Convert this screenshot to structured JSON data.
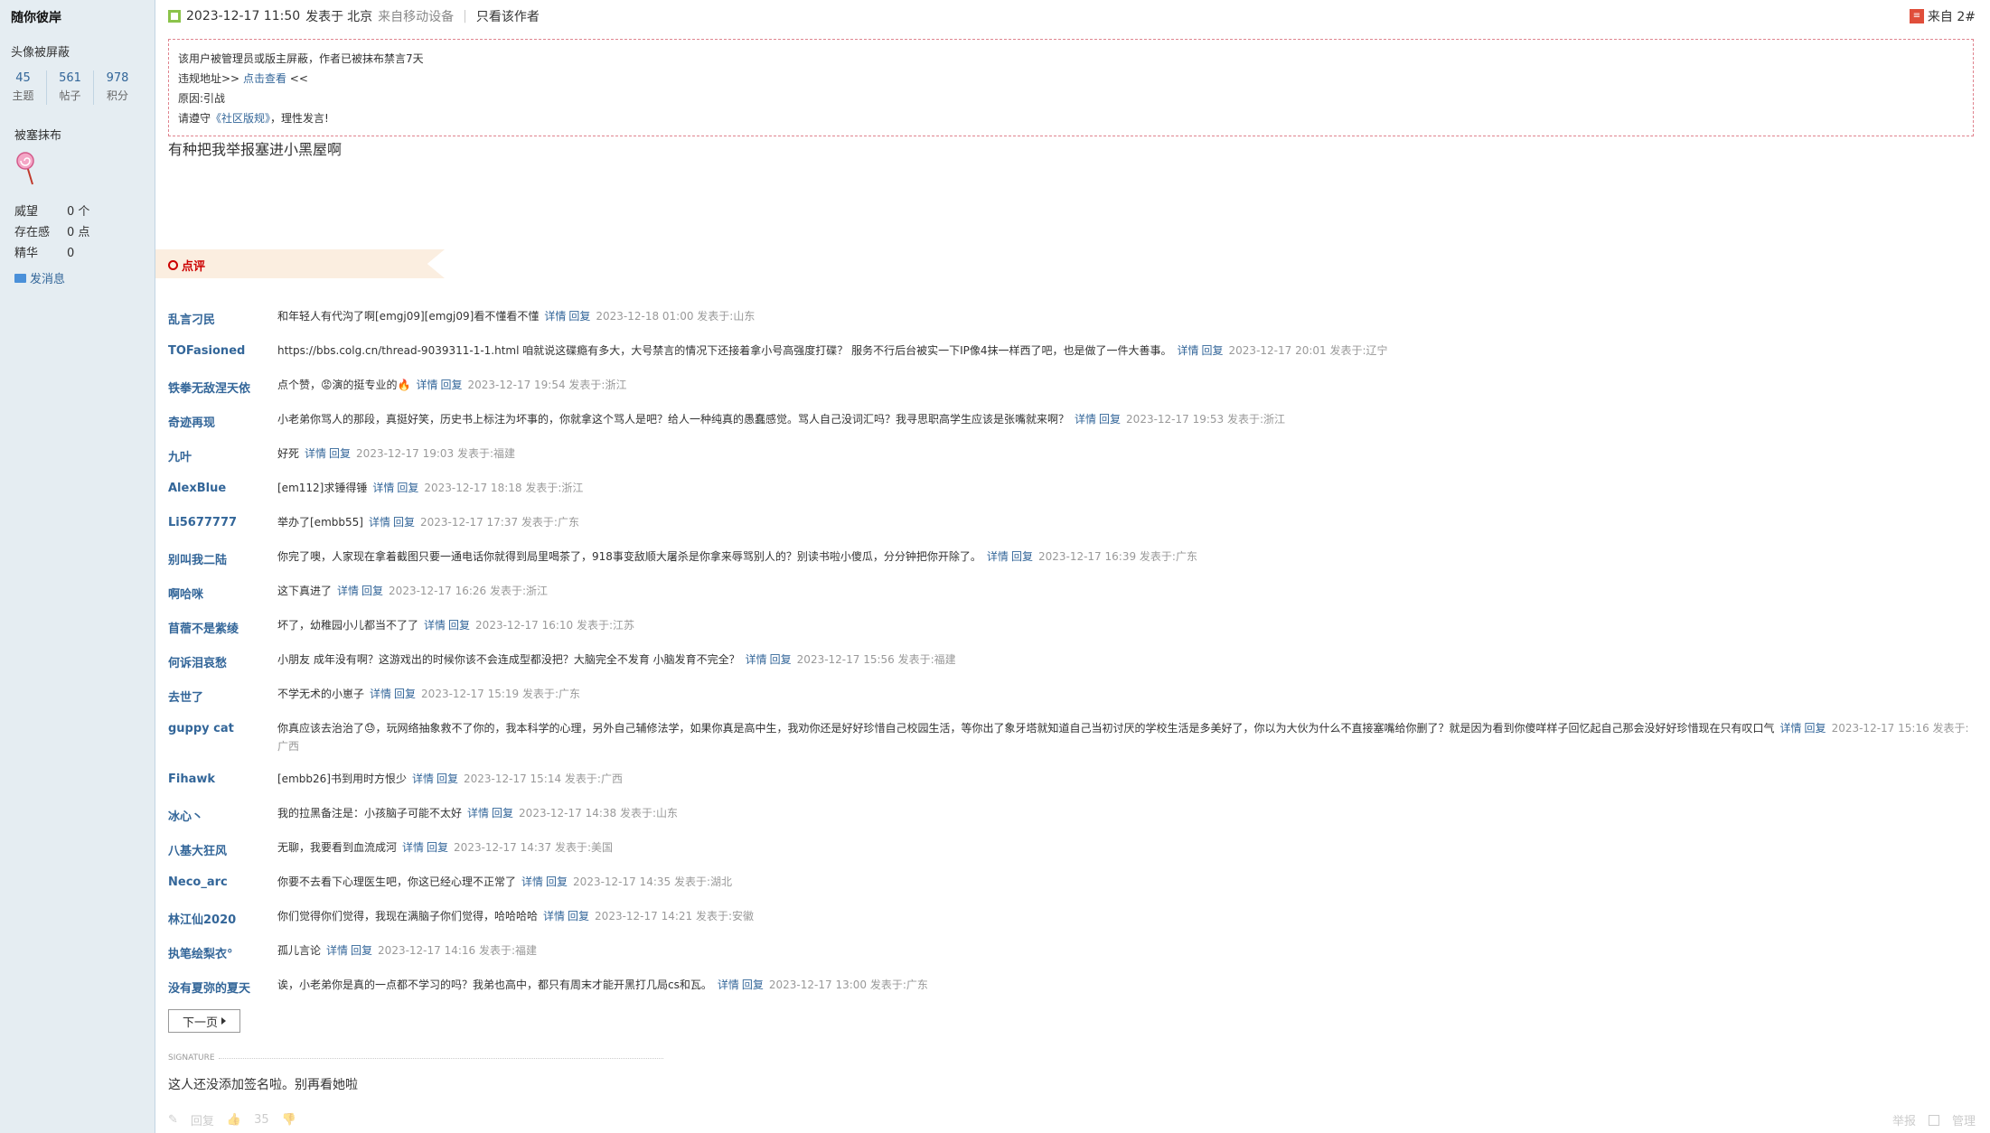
{
  "sidebar": {
    "username": "随你彼岸",
    "avatar_status": "头像被屏蔽",
    "stats": [
      {
        "value": "45",
        "label": "主题"
      },
      {
        "value": "561",
        "label": "帖子"
      },
      {
        "value": "978",
        "label": "积分"
      }
    ],
    "title": "被塞抹布",
    "rows": [
      {
        "key": "威望",
        "value": "0 个"
      },
      {
        "key": "存在感",
        "value": "0 点"
      },
      {
        "key": "精华",
        "value": "0"
      }
    ],
    "send_message": "发消息"
  },
  "post": {
    "date": "2023-12-17 11:50",
    "posted_in": "发表于",
    "location": "北京",
    "device": "来自移动设备",
    "only_author": "只看该作者",
    "floor": "来自 2#",
    "notice": {
      "line1": "该用户被管理员或版主屏蔽，作者已被抹布禁言7天",
      "line2_prefix": "违规地址>> ",
      "line2_link": "点击查看",
      "line2_suffix": " <<",
      "line3": "原因:引战",
      "line4_prefix": "请遵守",
      "line4_link": "《社区版规》",
      "line4_suffix": "，理性发言!"
    },
    "content": "有种把我举报塞进小黑屋啊"
  },
  "rating": {
    "label": "点评"
  },
  "comments": [
    {
      "user": "乱言刁民",
      "text": "和年轻人有代沟了啊[emgj09][emgj09]看不懂看不懂",
      "detail": "详情",
      "reply": "回复",
      "meta": "2023-12-18 01:00 发表于:山东"
    },
    {
      "user": "TOFasioned",
      "text": "https://bbs.colg.cn/thread-9039311-1-1.html 咱就说这碟瘾有多大，大号禁言的情况下还接着拿小号高强度打碟？ 服务不行后台被实一下IP像4抹一样西了吧，也是做了一件大善事。",
      "detail": "详情",
      "reply": "回复",
      "meta": "2023-12-17 20:01 发表于:辽宁"
    },
    {
      "user": "铁拳无敌涅天依",
      "text": "点个赞，😡演的挺专业的🔥",
      "detail": "详情",
      "reply": "回复",
      "meta": "2023-12-17 19:54 发表于:浙江"
    },
    {
      "user": "奇迹再现",
      "text": "小老弟你骂人的那段，真挺好笑，历史书上标注为坏事的，你就拿这个骂人是吧？给人一种纯真的愚蠢感觉。骂人自己没词汇吗？我寻思职高学生应该是张嘴就来啊？",
      "detail": "详情",
      "reply": "回复",
      "meta": "2023-12-17 19:53 发表于:浙江"
    },
    {
      "user": "九叶",
      "text": "好死",
      "detail": "详情",
      "reply": "回复",
      "meta": "2023-12-17 19:03 发表于:福建"
    },
    {
      "user": "AlexBlue",
      "text": "[em112]求锤得锤",
      "detail": "详情",
      "reply": "回复",
      "meta": "2023-12-17 18:18 发表于:浙江"
    },
    {
      "user": "Li5677777",
      "text": "举办了[embb55]",
      "detail": "详情",
      "reply": "回复",
      "meta": "2023-12-17 17:37 发表于:广东"
    },
    {
      "user": "别叫我二陆",
      "text": "你完了噢，人家现在拿着截图只要一通电话你就得到局里喝茶了，918事变敌顺大屠杀是你拿来辱骂别人的？别读书啦小傻瓜，分分钟把你开除了。",
      "detail": "详情",
      "reply": "回复",
      "meta": "2023-12-17 16:39 发表于:广东"
    },
    {
      "user": "啊哈咪",
      "text": "这下真进了",
      "detail": "详情",
      "reply": "回复",
      "meta": "2023-12-17 16:26 发表于:浙江"
    },
    {
      "user": "苜蓿不是紫绫",
      "text": "坏了，幼稚园小儿都当不了了",
      "detail": "详情",
      "reply": "回复",
      "meta": "2023-12-17 16:10 发表于:江苏"
    },
    {
      "user": "何诉泪哀愁",
      "text": "小朋友 成年没有啊？这游戏出的时候你该不会连成型都没把？大脑完全不发育 小脑发育不完全？",
      "detail": "详情",
      "reply": "回复",
      "meta": "2023-12-17 15:56 发表于:福建"
    },
    {
      "user": "去世了",
      "text": "不学无术的小崽子",
      "detail": "详情",
      "reply": "回复",
      "meta": "2023-12-17 15:19 发表于:广东"
    },
    {
      "user": "guppy cat",
      "text": "你真应该去治治了😓，玩网络抽象救不了你的，我本科学的心理，另外自己辅修法学，如果你真是高中生，我劝你还是好好珍惜自己校园生活，等你出了象牙塔就知道自己当初讨厌的学校生活是多美好了，你以为大伙为什么不直接塞嘴给你删了？就是因为看到你傻咩样子回忆起自己那会没好好珍惜现在只有叹口气",
      "detail": "详情",
      "reply": "回复",
      "meta": "2023-12-17 15:16 发表于:广西"
    },
    {
      "user": "Fihawk",
      "text": "[embb26]书到用时方恨少",
      "detail": "详情",
      "reply": "回复",
      "meta": "2023-12-17 15:14 发表于:广西"
    },
    {
      "user": "冰心丶",
      "text": "我的拉黑备注是：小孩脑子可能不太好",
      "detail": "详情",
      "reply": "回复",
      "meta": "2023-12-17 14:38 发表于:山东"
    },
    {
      "user": "八基大狂风",
      "text": "无聊，我要看到血流成河",
      "detail": "详情",
      "reply": "回复",
      "meta": "2023-12-17 14:37 发表于:美国"
    },
    {
      "user": "Neco_arc",
      "text": "你要不去看下心理医生吧，你这已经心理不正常了",
      "detail": "详情",
      "reply": "回复",
      "meta": "2023-12-17 14:35 发表于:湖北"
    },
    {
      "user": "林江仙2020",
      "text": "你们觉得你们觉得，我现在满脑子你们觉得，哈哈哈哈",
      "detail": "详情",
      "reply": "回复",
      "meta": "2023-12-17 14:21 发表于:安徽"
    },
    {
      "user": "执笔绘梨衣°",
      "text": "孤儿言论",
      "detail": "详情",
      "reply": "回复",
      "meta": "2023-12-17 14:16 发表于:福建"
    },
    {
      "user": "没有夏弥的夏天",
      "text": "诶，小老弟你是真的一点都不学习的吗？我弟也高中，都只有周末才能开黑打几局cs和瓦。",
      "detail": "详情",
      "reply": "回复",
      "meta": "2023-12-17 13:00 发表于:广东"
    }
  ],
  "pagination": {
    "next": "下一页"
  },
  "signature": {
    "label": "SIGNATURE",
    "text": "这人还没添加签名啦。别再看她啦"
  },
  "footer": {
    "reply": "回复",
    "likes": "35",
    "report": "举报",
    "manage": "管理"
  }
}
